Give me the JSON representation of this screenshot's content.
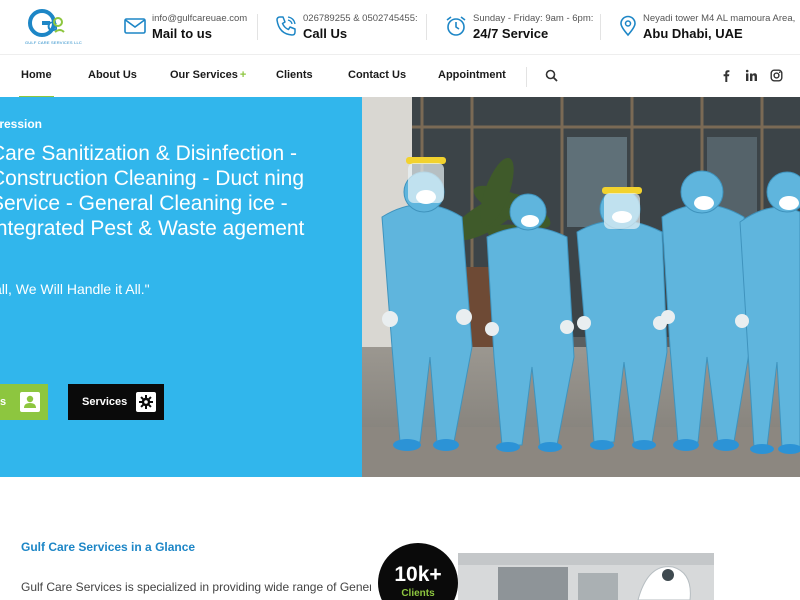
{
  "brand": {
    "logo_tagline": "GULF CARE SERVICES LLC",
    "accent": "#8dc63f",
    "primary": "#31b6ec",
    "link_blue": "#1d86c6"
  },
  "contact": {
    "email": {
      "icon": "envelope-icon",
      "small": "info@gulfcareuae.com",
      "big": "Mail to us"
    },
    "phone": {
      "icon": "phone-icon",
      "small": "026789255 & 0502745455:",
      "big": "Call Us"
    },
    "hours": {
      "icon": "alarm-clock-icon",
      "small": "Sunday - Friday: 9am - 6pm:",
      "big": "24/7 Service"
    },
    "address": {
      "icon": "location-pin-icon",
      "small": "Neyadi tower M4 AL mamoura Area,",
      "big": "Abu Dhabi, UAE"
    }
  },
  "nav": {
    "items": [
      {
        "label": "Home",
        "active": true
      },
      {
        "label": "About Us"
      },
      {
        "label": "Our Services",
        "has_submenu": true,
        "submenu_marker": "+"
      },
      {
        "label": "Clients"
      },
      {
        "label": "Contact Us"
      },
      {
        "label": "Appointment"
      }
    ],
    "search_icon": "search-icon",
    "social": [
      "facebook-icon",
      "linkedin-icon",
      "instagram-icon"
    ]
  },
  "hero": {
    "eyebrow": "gression",
    "title": "Care Sanitization & Disinfection - Construction Cleaning - Duct ning Service - General Cleaning ice - Integrated Pest & Waste agement",
    "quote": "all, We Will Handle it All.\"",
    "buttons": [
      {
        "label": "s",
        "icon": "user-icon"
      },
      {
        "label": "Services",
        "icon": "gear-icon"
      }
    ]
  },
  "about": {
    "title": "Gulf Care Services in a Glance",
    "text": "Gulf Care Services is specialized in providing wide range of General"
  },
  "stat": {
    "value": "10k+",
    "label": "Clients"
  }
}
